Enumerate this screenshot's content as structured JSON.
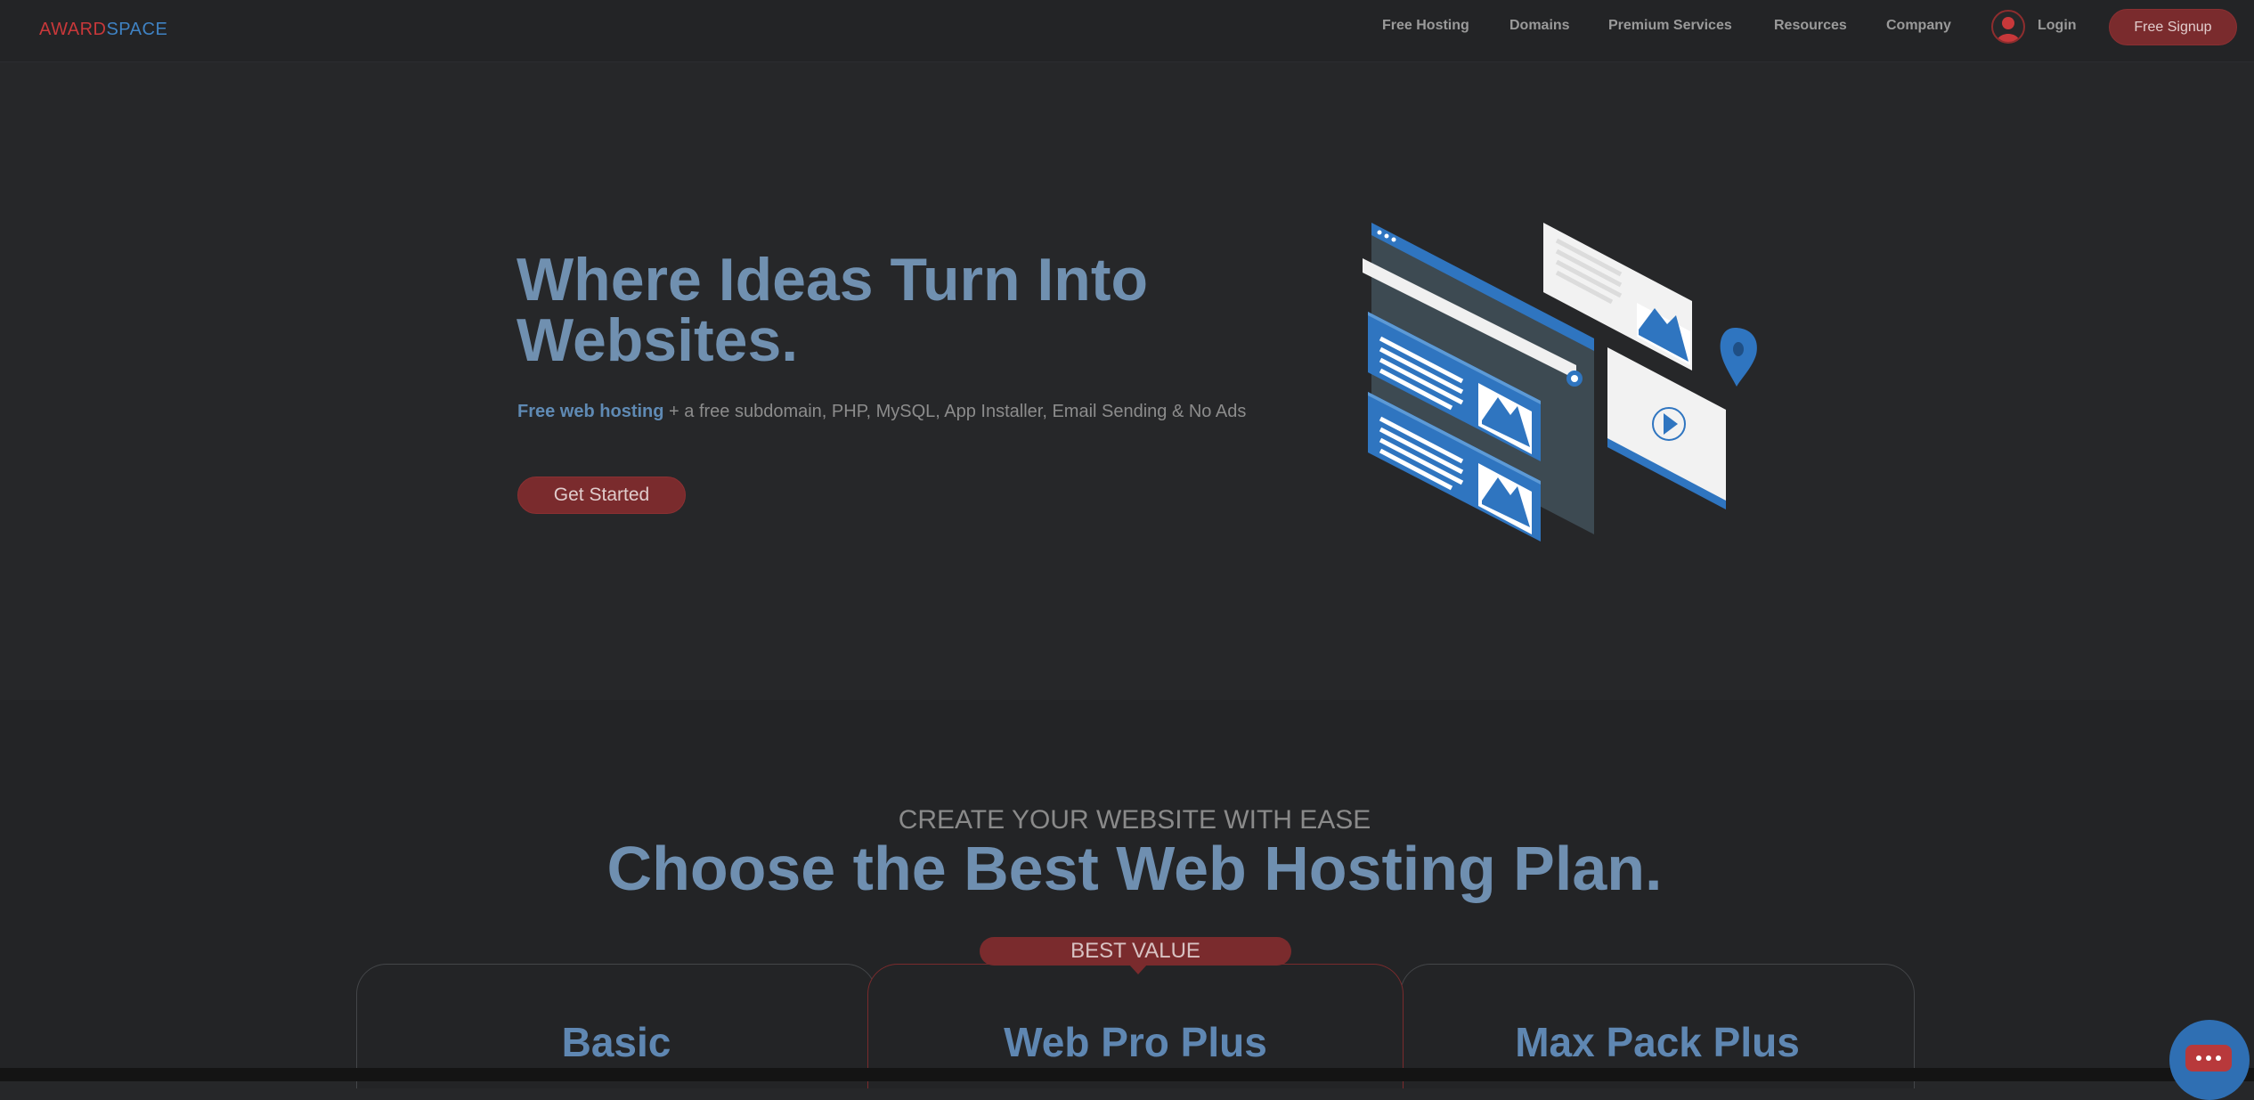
{
  "nav": {
    "logo_part1": "AWARD",
    "logo_part2": "SPACE",
    "links": [
      "Free Hosting",
      "Domains",
      "Premium Services",
      "Resources",
      "Company"
    ],
    "login_label": "Login",
    "signup_label": "Free Signup"
  },
  "hero": {
    "title": "Where Ideas Turn Into Websites.",
    "subtitle_highlight": "Free web hosting",
    "subtitle_rest": " + a free subdomain, PHP, MySQL, App Installer, Email Sending & No Ads",
    "cta_label": "Get Started"
  },
  "plans_section": {
    "eyebrow": "CREATE YOUR WEBSITE WITH EASE",
    "title": "Choose the Best Web Hosting Plan.",
    "badge": "BEST VALUE",
    "plans": [
      {
        "name": "Basic"
      },
      {
        "name": "Web Pro Plus"
      },
      {
        "name": "Max Pack Plus"
      }
    ]
  },
  "colors": {
    "background": "#262729",
    "accent_red": "#7a2b2d",
    "accent_blue": "#6f8fb0",
    "logo_red": "#c8383a",
    "logo_blue": "#3f82c3"
  },
  "icons": {
    "avatar": "user-avatar-icon",
    "chat": "chat-bubble-icon",
    "illustration": "website-builder-illustration"
  }
}
